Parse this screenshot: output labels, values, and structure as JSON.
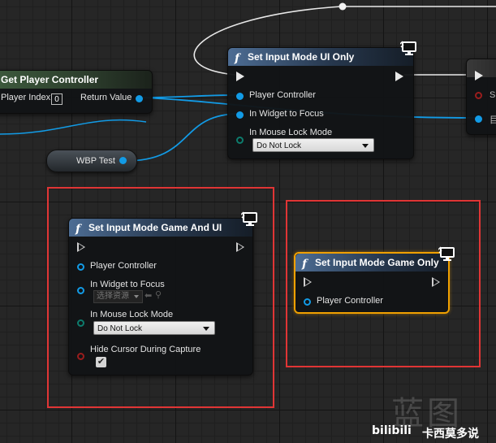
{
  "get_player_controller": {
    "title": "Get Player Controller",
    "player_index_label": "Player Index",
    "player_index_value": "0",
    "return_value_label": "Return Value"
  },
  "wbp_test": {
    "label": "WBP Test"
  },
  "set_ui_only": {
    "title": "Set Input Mode UI Only",
    "player_controller_label": "Player Controller",
    "widget_focus_label": "In Widget to Focus",
    "mouse_lock_label": "In Mouse Lock Mode",
    "mouse_lock_value": "Do Not Lock"
  },
  "partial_node": {
    "label_a": "Sh",
    "label_b": "目"
  },
  "set_game_and_ui": {
    "title": "Set Input Mode Game And UI",
    "player_controller_label": "Player Controller",
    "widget_focus_label": "In Widget to Focus",
    "widget_focus_value": "选择资源",
    "mouse_lock_label": "In Mouse Lock Mode",
    "mouse_lock_value": "Do Not Lock",
    "hide_cursor_label": "Hide Cursor During Capture",
    "hide_cursor_checked": "✔"
  },
  "set_game_only": {
    "title": "Set Input Mode Game Only",
    "player_controller_label": "Player Controller"
  },
  "watermark": {
    "logo_text": "蓝图",
    "site_text": "bilibili",
    "author_text": "卡西莫多说"
  },
  "colors": {
    "object_pin": "#129be6",
    "enum_pin": "#0d7c6d",
    "bool_pin": "#9a1d1d",
    "selection_box": "#e03535",
    "selected_node": "#f0a000",
    "function_header": "#4d6d94",
    "pure_header": "#3d5a3d"
  },
  "icons": {
    "function": "function-icon",
    "target": "monitor-target-icon",
    "exec": "exec-pin-icon",
    "browse": "browse-arrow-icon",
    "search": "search-icon",
    "checkmark": "checkmark-icon"
  }
}
